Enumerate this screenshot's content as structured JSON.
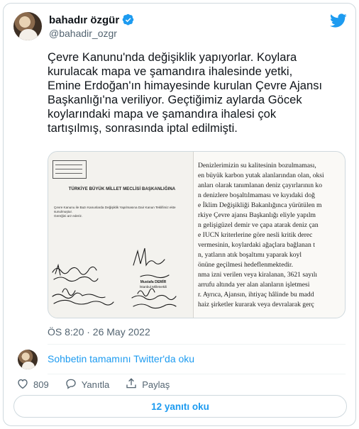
{
  "author": {
    "display_name": "bahadır özgür",
    "handle": "@bahadir_ozgr"
  },
  "tweet": {
    "text": "Çevre Kanunu'nda değişiklik yapıyorlar. Koylara\nkurulacak mapa ve şamandıra ihalesinde yetki,\nEmine Erdoğan'ın himayesinde kurulan Çevre Ajansı\nBaşkanlığı'na veriliyor. Geçtiğimiz aylarda Göcek\nkoylarındaki mapa ve şamandıra ihalesi çok\ntartışılmış, sonrasında iptal edilmişti.",
    "timestamp": "ÖS 8:20 · 26 May 2022"
  },
  "document": {
    "heading": "TÜRKİYE BÜYÜK MİLLET MECLİSİ BAŞKANLIĞINA",
    "subject": "Çevre Kanunu ile Bazı Kanunlarda Değişiklik Yapılmasına Dair Kanun Teklifimiz ekte sunulmuştur.\n    Gereğini arz ederiz.",
    "signer_name": "Mustafa DEMİR",
    "signer_title": "İstanbul Milletvekili",
    "right_lines": [
      "Denizlerimizin su kalitesinin bozulmaması,",
      "en büyük karbon yutak alanlarından olan, oksi",
      "anları olarak tanımlanan deniz çayırlarının ko",
      "n denizlere boşaltılmaması ve kıyıdaki doğ",
      "e İklim Değişikliği Bakanlığınca yürütülen m",
      "rkiye Çevre ajansı Başkanlığı eliyle yapılm",
      "n gelişigüzel demir ve çapa atarak deniz çan",
      "e IUCN kriterlerine göre nesli kritik derec",
      "vermesinin, koylardaki ağaçlara bağlanan t",
      "n, yatların atık boşaltımı yaparak koyl",
      "önüne geçilmesi hedeflenmektedir.",
      "nma izni verilen veya kiralanan, 3621 sayılı",
      "arrufu altında yer alan alanların işletmesi",
      "r. Ayrıca, Ajansın, ihtiyaç hâlinde bu madd",
      "haiz şirketler kurarak veya devralarak gerç"
    ]
  },
  "conversation": {
    "link_label": "Sohbetin tamamını Twitter'da oku"
  },
  "actions": {
    "like_count": "809",
    "reply_label": "Yanıtla",
    "share_label": "Paylaş"
  },
  "replies": {
    "button_label": "12 yanıtı oku"
  },
  "colors": {
    "accent": "#1d9bf0",
    "secondary_text": "#536471",
    "primary_text": "#0f1419",
    "border": "#cfd9de"
  }
}
